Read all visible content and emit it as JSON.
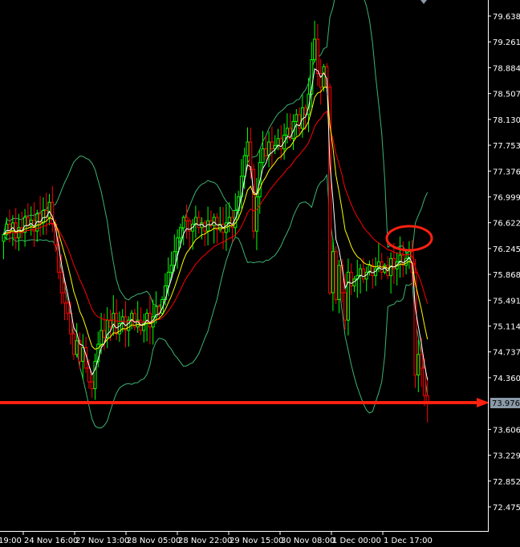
{
  "chart_data": {
    "type": "candlestick",
    "title": "",
    "colors": {
      "bull": "#00ff00",
      "bear": "#ff0000",
      "ma_fast": "#ffffff",
      "ma_mid": "#ffff00",
      "ma_slow": "#ff0000",
      "bands": "#3cb371",
      "last_price_line": "#ff2010",
      "marker": "#ff2010"
    },
    "y_range": [
      72.475,
      79.638
    ],
    "y_ticks": [
      "79.638",
      "79.261",
      "78.884",
      "78.507",
      "78.130",
      "77.753",
      "77.376",
      "76.999",
      "76.622",
      "76.245",
      "75.868",
      "75.491",
      "75.114",
      "74.737",
      "74.360",
      "73.606",
      "73.229",
      "72.852",
      "72.475"
    ],
    "x_ticks": [
      "19:00",
      "24 Nov 16:00",
      "27 Nov 13:00",
      "28 Nov 05:00",
      "28 Nov 22:00",
      "29 Nov 15:00",
      "30 Nov 08:00",
      "1 Dec 00:00",
      "1 Dec 17:00"
    ],
    "last_price": "73.976",
    "closes": [
      76.45,
      76.6,
      76.5,
      76.62,
      76.4,
      76.55,
      76.48,
      76.7,
      76.58,
      76.66,
      76.5,
      76.75,
      76.62,
      76.8,
      76.7,
      76.92,
      76.6,
      76.3,
      75.9,
      75.6,
      75.45,
      75.3,
      75.0,
      74.7,
      74.9,
      74.6,
      74.8,
      74.5,
      74.3,
      74.2,
      74.6,
      74.85,
      75.05,
      74.95,
      75.2,
      75.1,
      75.3,
      75.0,
      75.15,
      75.25,
      75.05,
      75.2,
      75.3,
      75.1,
      75.2,
      75.05,
      75.15,
      75.3,
      75.1,
      75.25,
      75.4,
      75.3,
      75.5,
      75.7,
      75.9,
      76.0,
      76.2,
      76.4,
      76.55,
      76.7,
      76.65,
      76.5,
      76.6,
      76.7,
      76.55,
      76.62,
      76.5,
      76.65,
      76.58,
      76.7,
      76.52,
      76.6,
      76.48,
      76.62,
      76.7,
      76.55,
      76.8,
      77.0,
      77.3,
      77.6,
      77.8,
      77.4,
      76.5,
      77.0,
      77.5,
      77.7,
      77.6,
      77.8,
      77.7,
      77.75,
      77.85,
      77.7,
      77.9,
      78.0,
      77.85,
      78.1,
      78.2,
      78.0,
      78.3,
      78.2,
      78.5,
      79.0,
      79.3,
      78.8,
      78.6,
      78.9,
      78.6,
      75.6,
      76.2,
      75.5,
      76.0,
      75.6,
      75.2,
      75.9,
      75.7,
      75.8,
      75.85,
      75.95,
      75.8,
      75.9,
      76.0,
      75.85,
      75.95,
      76.05,
      75.9,
      76.0,
      75.85,
      76.1,
      75.95,
      76.05,
      76.15,
      76.0,
      76.1,
      76.2,
      75.9,
      74.4,
      74.7,
      74.5,
      74.1,
      73.98
    ]
  }
}
